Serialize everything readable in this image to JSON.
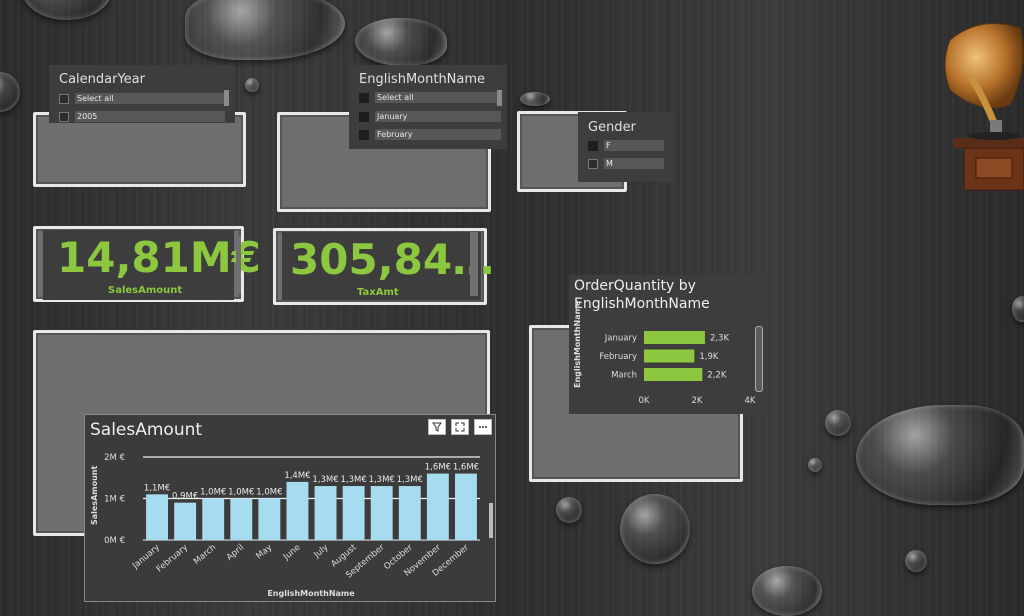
{
  "slicers": {
    "calendar_year": {
      "title": "CalendarYear",
      "items": [
        "Select all",
        "2005"
      ]
    },
    "month": {
      "title": "EnglishMonthName",
      "items": [
        "Select all",
        "January",
        "February"
      ]
    },
    "gender": {
      "title": "Gender",
      "items": [
        "F",
        "M"
      ]
    }
  },
  "kpis": [
    {
      "value": "14,81M€",
      "label": "SalesAmount"
    },
    {
      "value": "305,84…",
      "label": "TaxAmt"
    }
  ],
  "order_chart": {
    "title_line1": "OrderQuantity by",
    "title_line2": "EnglishMonthName",
    "ylabel": "EnglishMonthName",
    "x_ticks": [
      "0K",
      "2K",
      "4K"
    ],
    "bar_color": "#8dc63f"
  },
  "sales_chart": {
    "title": "SalesAmount",
    "xlabel": "EnglishMonthName",
    "ylabel": "SalesAmount",
    "y_ticks": [
      "2M €",
      "1M €",
      "0M €"
    ],
    "bar_color": "#a6dcef",
    "toolbar": {
      "filter_icon": "filter-icon",
      "focus_icon": "focus-mode-icon",
      "more_icon": "more-options-icon"
    }
  },
  "chart_data": [
    {
      "type": "bar",
      "orientation": "horizontal",
      "title": "OrderQuantity by EnglishMonthName",
      "ylabel": "EnglishMonthName",
      "categories": [
        "January",
        "February",
        "March"
      ],
      "values": [
        2300,
        1900,
        2200
      ],
      "data_labels": [
        "2,3K",
        "1,9K",
        "2,2K"
      ],
      "xlim": [
        0,
        4000
      ],
      "x_ticks": [
        "0K",
        "2K",
        "4K"
      ]
    },
    {
      "type": "bar",
      "title": "SalesAmount",
      "xlabel": "EnglishMonthName",
      "ylabel": "SalesAmount",
      "categories": [
        "January",
        "February",
        "March",
        "April",
        "May",
        "June",
        "July",
        "August",
        "September",
        "October",
        "November",
        "December"
      ],
      "values": [
        1.1,
        0.9,
        1.0,
        1.0,
        1.0,
        1.4,
        1.3,
        1.3,
        1.3,
        1.3,
        1.6,
        1.6
      ],
      "data_labels": [
        "1,1M€",
        "0,9M€",
        "1,0M€",
        "1,0M€",
        "1,0M€",
        "1,4M€",
        "1,3M€",
        "1,3M€",
        "1,3M€",
        "1,3M€",
        "1,6M€",
        "1,6M€"
      ],
      "ylim": [
        0,
        2
      ],
      "y_ticks": [
        "2M €",
        "1M €",
        "0M €"
      ],
      "grid": true
    }
  ]
}
